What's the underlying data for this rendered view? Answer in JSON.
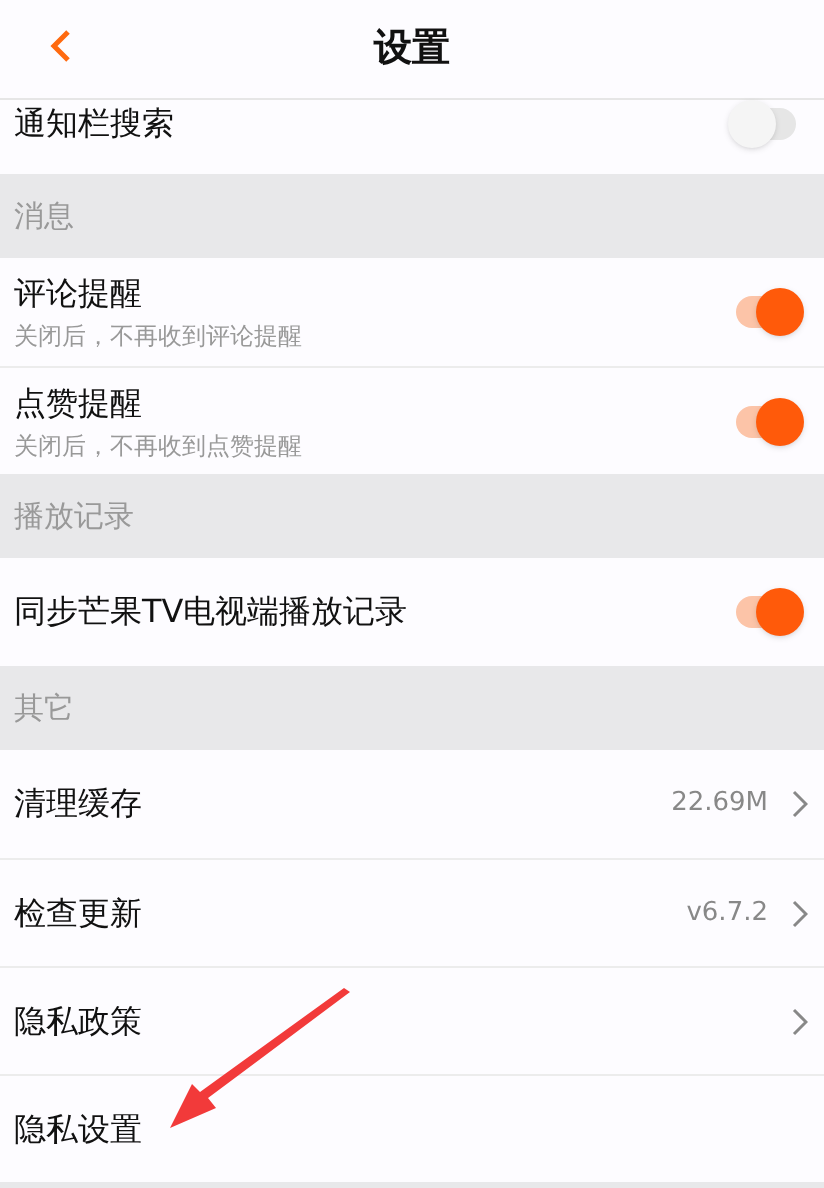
{
  "header": {
    "title": "设置"
  },
  "sections": [
    {
      "items": [
        {
          "kind": "toggle",
          "label": "通知栏搜索",
          "on": false
        }
      ]
    },
    {
      "title": "消息",
      "items": [
        {
          "kind": "toggle",
          "label": "评论提醒",
          "hint": "关闭后，不再收到评论提醒",
          "on": true
        },
        {
          "kind": "toggle",
          "label": "点赞提醒",
          "hint": "关闭后，不再收到点赞提醒",
          "on": true
        }
      ]
    },
    {
      "title": "播放记录",
      "items": [
        {
          "kind": "toggle",
          "label": "同步芒果TV电视端播放记录",
          "on": true
        }
      ]
    },
    {
      "title": "其它",
      "items": [
        {
          "kind": "link",
          "label": "清理缓存",
          "value": "22.69M"
        },
        {
          "kind": "link",
          "label": "检查更新",
          "value": "v6.7.2"
        },
        {
          "kind": "link",
          "label": "隐私政策"
        },
        {
          "kind": "link",
          "label": "隐私设置",
          "chevron": false
        }
      ]
    }
  ]
}
